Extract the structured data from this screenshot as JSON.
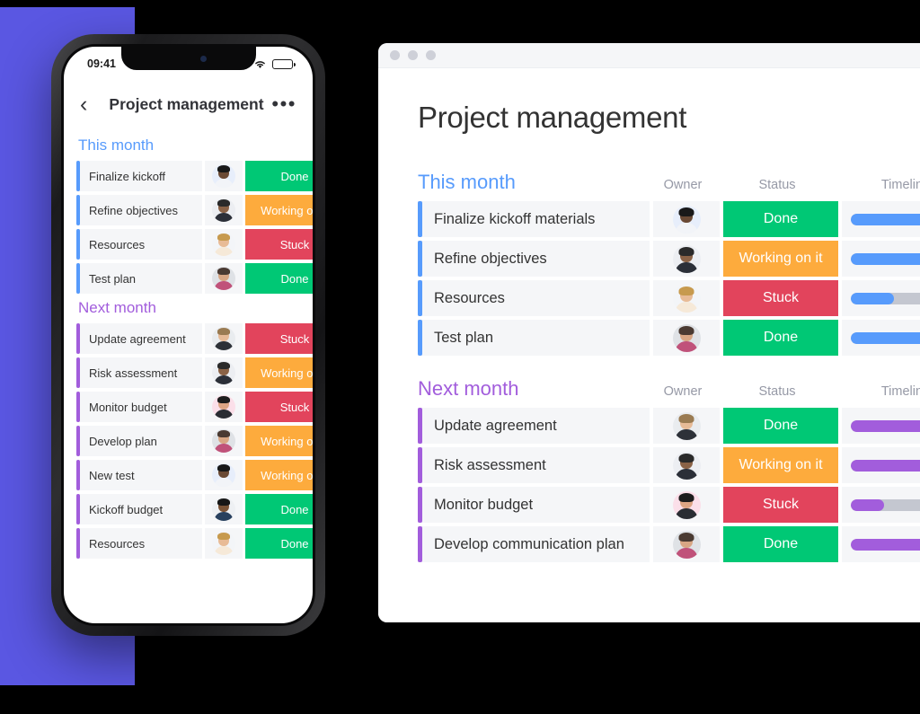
{
  "colors": {
    "done": "#00C875",
    "working": "#FDAB3D",
    "stuck": "#E2445C",
    "blue_accent": "#579BFC",
    "purple_accent": "#A25DDC",
    "brand_purple": "#5A57E2",
    "row_bg": "#f5f6f8",
    "track_gray": "#c4c7d0"
  },
  "desktop": {
    "window_dots": [
      "dot-1",
      "dot-2",
      "dot-3"
    ],
    "title": "Project management",
    "columns": {
      "owner": "Owner",
      "status": "Status",
      "timeline": "Timeline"
    },
    "groups": [
      {
        "title": "This month",
        "accent": "blue",
        "bar_color": "#579BFC",
        "rows": [
          {
            "name": "Finalize kickoff materials",
            "status": "Done",
            "status_color": "#00C875",
            "timeline_pct": 78,
            "avatar": "avatar-woman-glasses"
          },
          {
            "name": "Refine objectives",
            "status": "Working on it",
            "status_color": "#FDAB3D",
            "timeline_pct": 78,
            "avatar": "avatar-man-beard-dark"
          },
          {
            "name": "Resources",
            "status": "Stuck",
            "status_color": "#E2445C",
            "timeline_pct": 28,
            "avatar": "avatar-woman-blonde"
          },
          {
            "name": "Test plan",
            "status": "Done",
            "status_color": "#00C875",
            "timeline_pct": 100,
            "avatar": "avatar-man-beard"
          }
        ]
      },
      {
        "title": "Next month",
        "accent": "purple",
        "bar_color": "#A25DDC",
        "rows": [
          {
            "name": "Update agreement",
            "status": "Done",
            "status_color": "#00C875",
            "timeline_pct": 100,
            "avatar": "avatar-man-blond"
          },
          {
            "name": "Risk assessment",
            "status": "Working on it",
            "status_color": "#FDAB3D",
            "timeline_pct": 72,
            "avatar": "avatar-man-beard-dark"
          },
          {
            "name": "Monitor budget",
            "status": "Stuck",
            "status_color": "#E2445C",
            "timeline_pct": 22,
            "avatar": "avatar-woman-dark-hair"
          },
          {
            "name": "Develop communication plan",
            "status": "Done",
            "status_color": "#00C875",
            "timeline_pct": 100,
            "avatar": "avatar-man-beard"
          }
        ]
      }
    ]
  },
  "phone": {
    "statusbar": {
      "time": "09:41",
      "wifi": "wifi-icon",
      "battery": "battery-icon"
    },
    "nav": {
      "back": "‹",
      "title": "Project management",
      "more": "•••"
    },
    "groups": [
      {
        "title": "This month",
        "accent": "blue",
        "rows": [
          {
            "name": "Finalize kickoff",
            "status": "Done",
            "status_color": "#00C875",
            "avatar": "avatar-woman-glasses"
          },
          {
            "name": "Refine objectives",
            "status": "Working on it",
            "status_color": "#FDAB3D",
            "avatar": "avatar-man-beard-dark"
          },
          {
            "name": "Resources",
            "status": "Stuck",
            "status_color": "#E2445C",
            "avatar": "avatar-woman-blonde"
          },
          {
            "name": "Test plan",
            "status": "Done",
            "status_color": "#00C875",
            "avatar": "avatar-man-beard"
          }
        ]
      },
      {
        "title": "Next month",
        "accent": "purple",
        "rows": [
          {
            "name": "Update agreement",
            "status": "Stuck",
            "status_color": "#E2445C",
            "avatar": "avatar-man-blond"
          },
          {
            "name": "Risk assessment",
            "status": "Working on it",
            "status_color": "#FDAB3D",
            "avatar": "avatar-man-beard-dark"
          },
          {
            "name": "Monitor budget",
            "status": "Stuck",
            "status_color": "#E2445C",
            "avatar": "avatar-woman-dark-hair"
          },
          {
            "name": "Develop plan",
            "status": "Working on it",
            "status_color": "#FDAB3D",
            "avatar": "avatar-man-beard"
          },
          {
            "name": "New test",
            "status": "Working on it",
            "status_color": "#FDAB3D",
            "avatar": "avatar-woman-glasses"
          },
          {
            "name": "Kickoff budget",
            "status": "Done",
            "status_color": "#00C875",
            "avatar": "avatar-man-dark-suit"
          },
          {
            "name": "Resources",
            "status": "Done",
            "status_color": "#00C875",
            "avatar": "avatar-woman-blonde"
          }
        ]
      }
    ]
  }
}
